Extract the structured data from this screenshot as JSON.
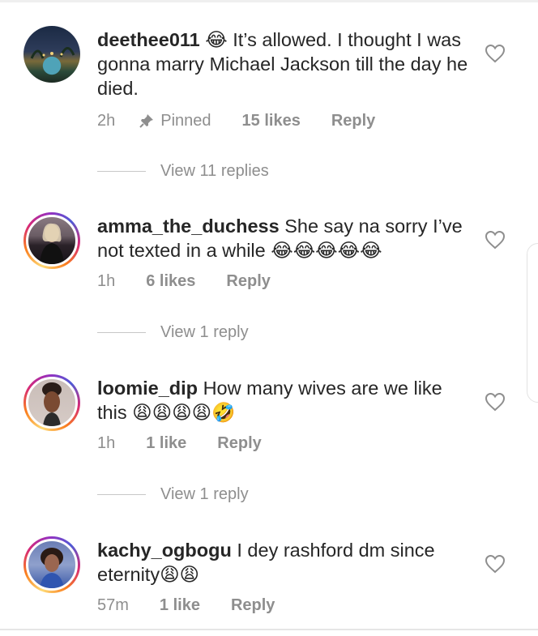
{
  "comments": [
    {
      "username": "deethee011",
      "text": "😂 It’s allowed. I thought I was gonna marry Michael Jackson till the day he died.",
      "time": "2h",
      "pinned_label": "Pinned",
      "likes": "15 likes",
      "reply_label": "Reply",
      "view_replies": "View 11 replies",
      "heart_icon": "heart-outline-icon"
    },
    {
      "username": "amma_the_duchess",
      "text": "She say na sorry I’ve not texted in a while 😂😂😂😂😂",
      "time": "1h",
      "likes": "6 likes",
      "reply_label": "Reply",
      "view_replies": "View 1 reply",
      "heart_icon": "heart-outline-icon"
    },
    {
      "username": "loomie_dip",
      "text": "How many wives are we like this 😩😩😩😩🤣",
      "time": "1h",
      "likes": "1 like",
      "reply_label": "Reply",
      "view_replies": "View 1 reply",
      "heart_icon": "heart-outline-icon"
    },
    {
      "username": "kachy_ogbogu",
      "text": "I dey rashford dm since eternity😩😩",
      "time": "57m",
      "likes": "1 like",
      "reply_label": "Reply",
      "heart_icon": "heart-outline-icon"
    }
  ],
  "colors": {
    "text": "#262626",
    "secondary": "#8e8e8e",
    "story_ring": [
      "#feda75",
      "#fa7e1e",
      "#d62976",
      "#962fbf",
      "#4f5bd5"
    ]
  }
}
